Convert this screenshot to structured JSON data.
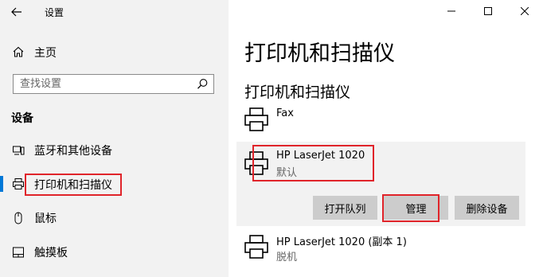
{
  "window": {
    "title": "设置",
    "controls": [
      "minimize-icon",
      "maximize-icon",
      "close-icon"
    ]
  },
  "sidebar": {
    "home_label": "主页",
    "search_placeholder": "查找设置",
    "section_title": "设备",
    "items": [
      {
        "label": "蓝牙和其他设备",
        "icon": "bluetooth-devices-icon",
        "active": false
      },
      {
        "label": "打印机和扫描仪",
        "icon": "printer-icon",
        "active": true
      },
      {
        "label": "鼠标",
        "icon": "mouse-icon",
        "active": false
      },
      {
        "label": "触摸板",
        "icon": "touchpad-icon",
        "active": false
      }
    ]
  },
  "main": {
    "page_title": "打印机和扫描仪",
    "section_title": "打印机和扫描仪",
    "devices": [
      {
        "name": "Fax",
        "status": "",
        "icon": "printer-icon"
      },
      {
        "name": "HP LaserJet 1020",
        "status": "默认",
        "icon": "printer-icon",
        "selected": true
      },
      {
        "name": "HP LaserJet 1020 (副本 1)",
        "status": "脱机",
        "icon": "printer-icon"
      }
    ],
    "buttons": {
      "open_queue": "打开队列",
      "manage": "管理",
      "remove": "删除设备"
    }
  },
  "colors": {
    "accent": "#0078d7",
    "annotation": "#e0242a",
    "sidebar_bg": "#f2f2f2",
    "button_bg": "#cccccc"
  }
}
